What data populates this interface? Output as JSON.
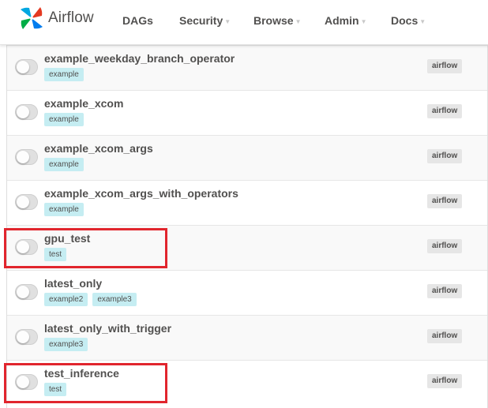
{
  "navbar": {
    "brand": "Airflow",
    "items": [
      {
        "label": "DAGs",
        "dropdown": false
      },
      {
        "label": "Security",
        "dropdown": true
      },
      {
        "label": "Browse",
        "dropdown": true
      },
      {
        "label": "Admin",
        "dropdown": true
      },
      {
        "label": "Docs",
        "dropdown": true
      }
    ],
    "caret": "▼"
  },
  "colors": {
    "highlight": "#e1252d",
    "tag_background": "#c5edf2",
    "owner_background": "#e6e6e6"
  },
  "dags": [
    {
      "id": "example_weekday_branch_operator",
      "tags": [
        "example"
      ],
      "owner": "airflow",
      "paused": true,
      "highlighted": false
    },
    {
      "id": "example_xcom",
      "tags": [
        "example"
      ],
      "owner": "airflow",
      "paused": true,
      "highlighted": false
    },
    {
      "id": "example_xcom_args",
      "tags": [
        "example"
      ],
      "owner": "airflow",
      "paused": true,
      "highlighted": false
    },
    {
      "id": "example_xcom_args_with_operators",
      "tags": [
        "example"
      ],
      "owner": "airflow",
      "paused": true,
      "highlighted": false
    },
    {
      "id": "gpu_test",
      "tags": [
        "test"
      ],
      "owner": "airflow",
      "paused": true,
      "highlighted": true
    },
    {
      "id": "latest_only",
      "tags": [
        "example2",
        "example3"
      ],
      "owner": "airflow",
      "paused": true,
      "highlighted": false
    },
    {
      "id": "latest_only_with_trigger",
      "tags": [
        "example3"
      ],
      "owner": "airflow",
      "paused": true,
      "highlighted": false
    },
    {
      "id": "test_inference",
      "tags": [
        "test"
      ],
      "owner": "airflow",
      "paused": true,
      "highlighted": true
    }
  ]
}
